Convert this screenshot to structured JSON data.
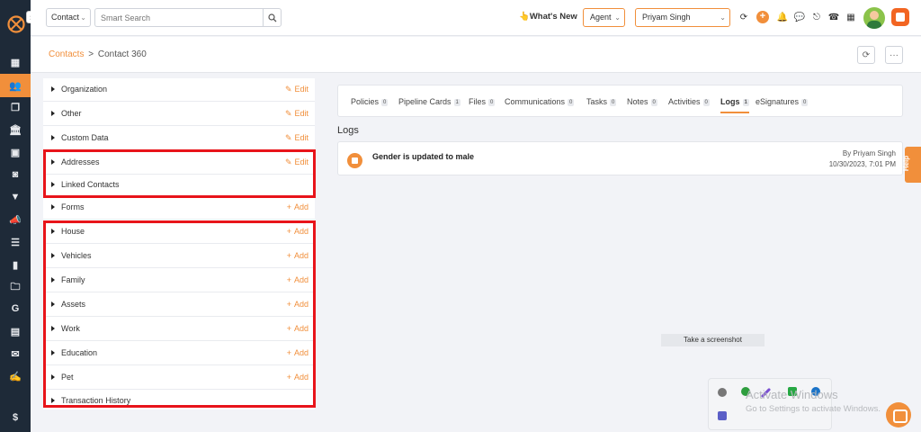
{
  "topbar": {
    "entity_select": "Contact",
    "search_placeholder": "Smart Search",
    "whats_new": "What's New",
    "role_select": "Agent",
    "user_select": "Priyam Singh"
  },
  "breadcrumb": {
    "parent": "Contacts",
    "separator": ">",
    "current": "Contact 360"
  },
  "sections": [
    {
      "label": "Organization",
      "action": "Edit"
    },
    {
      "label": "Other",
      "action": "Edit"
    },
    {
      "label": "Custom Data",
      "action": "Edit"
    },
    {
      "label": "Addresses",
      "action": "Edit"
    },
    {
      "label": "Linked Contacts",
      "action": ""
    },
    {
      "label": "Forms",
      "action": "Add"
    },
    {
      "label": "House",
      "action": "Add"
    },
    {
      "label": "Vehicles",
      "action": "Add"
    },
    {
      "label": "Family",
      "action": "Add"
    },
    {
      "label": "Assets",
      "action": "Add"
    },
    {
      "label": "Work",
      "action": "Add"
    },
    {
      "label": "Education",
      "action": "Add"
    },
    {
      "label": "Pet",
      "action": "Add"
    },
    {
      "label": "Transaction History",
      "action": ""
    }
  ],
  "tabs": [
    {
      "label": "Policies",
      "count": "0"
    },
    {
      "label": "Pipeline Cards",
      "count": "1"
    },
    {
      "label": "Files",
      "count": "0"
    },
    {
      "label": "Communications",
      "count": "0"
    },
    {
      "label": "Tasks",
      "count": "0"
    },
    {
      "label": "Notes",
      "count": "0"
    },
    {
      "label": "Activities",
      "count": "0"
    },
    {
      "label": "Logs",
      "count": "1"
    },
    {
      "label": "eSignatures",
      "count": "0"
    }
  ],
  "active_tab": "Logs",
  "logs": {
    "title": "Logs",
    "entries": [
      {
        "message": "Gender is updated to male",
        "by": "By Priyam Singh",
        "when": "10/30/2023, 7:01 PM"
      }
    ]
  },
  "help_label": "Help",
  "screenshot_tip": "Take a screenshot",
  "watermark": {
    "title": "Activate Windows",
    "subtitle": "Go to Settings to activate Windows."
  },
  "colors": {
    "accent": "#f18f3b",
    "nav_bg": "#1e2a38",
    "highlight": "#e8141a"
  },
  "icons": {
    "nav": [
      "dashboard-icon",
      "contacts-icon",
      "documents-icon",
      "bank-icon",
      "id-card-icon",
      "filter-icon",
      "megaphone-icon",
      "notes-icon",
      "chart-icon",
      "folder-icon",
      "google-icon",
      "calendar-icon",
      "mail-icon",
      "signature-icon",
      "dollar-icon"
    ]
  }
}
